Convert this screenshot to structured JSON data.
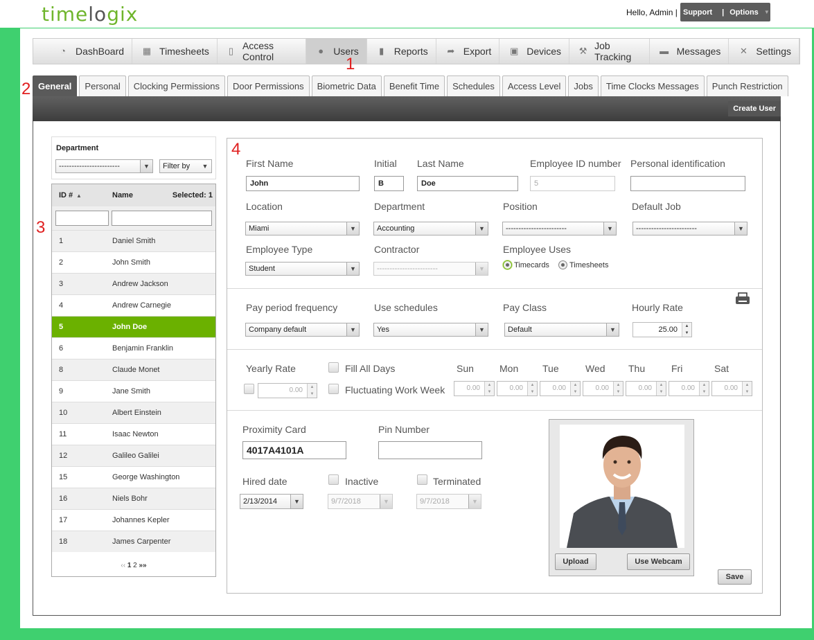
{
  "brand": {
    "logo_part1": "time",
    "logo_part2": "l",
    "logo_part3": "gix"
  },
  "topright": {
    "greeting": "Hello, Admin |",
    "support": "Support",
    "sep": "|",
    "options": "Options"
  },
  "menu": [
    {
      "label": "DashBoard",
      "icon": "dashboard-icon"
    },
    {
      "label": "Timesheets",
      "icon": "timesheets-icon"
    },
    {
      "label": "Access Control",
      "icon": "door-icon"
    },
    {
      "label": "Users",
      "icon": "user-icon"
    },
    {
      "label": "Reports",
      "icon": "bar-chart-icon"
    },
    {
      "label": "Export",
      "icon": "export-icon"
    },
    {
      "label": "Devices",
      "icon": "devices-icon"
    },
    {
      "label": "Job Tracking",
      "icon": "job-tracking-icon"
    },
    {
      "label": "Messages",
      "icon": "message-icon"
    },
    {
      "label": "Settings",
      "icon": "settings-icon"
    }
  ],
  "markers": {
    "m1": "1",
    "m2": "2",
    "m3": "3",
    "m4": "4"
  },
  "tabs": [
    "General",
    "Personal",
    "Clocking Permissions",
    "Door Permissions",
    "Biometric Data",
    "Benefit Time",
    "Schedules",
    "Access Level",
    "Jobs",
    "Time Clocks Messages",
    "Punch Restriction"
  ],
  "create_user": "Create User",
  "department_filter": {
    "label": "Department",
    "value": "------------------------",
    "filter_by": "Filter by"
  },
  "list": {
    "col_id": "ID #",
    "col_name": "Name",
    "selected": "Selected: 1",
    "rows": [
      {
        "id": "1",
        "name": "Daniel Smith"
      },
      {
        "id": "2",
        "name": "John Smith"
      },
      {
        "id": "3",
        "name": "Andrew Jackson"
      },
      {
        "id": "4",
        "name": "Andrew Carnegie"
      },
      {
        "id": "5",
        "name": "John Doe"
      },
      {
        "id": "6",
        "name": "Benjamin Franklin"
      },
      {
        "id": "8",
        "name": "Claude Monet"
      },
      {
        "id": "9",
        "name": "Jane Smith"
      },
      {
        "id": "10",
        "name": "Albert Einstein"
      },
      {
        "id": "11",
        "name": "Isaac Newton"
      },
      {
        "id": "12",
        "name": "Galileo Galilei"
      },
      {
        "id": "15",
        "name": "George Washington"
      },
      {
        "id": "16",
        "name": "Niels Bohr"
      },
      {
        "id": "17",
        "name": "Johannes Kepler"
      },
      {
        "id": "18",
        "name": "James Carpenter"
      }
    ],
    "pager": {
      "prev": "‹‹",
      "p1": "1",
      "p2": "2",
      "next": "»»"
    }
  },
  "form": {
    "first_name_label": "First Name",
    "first_name": "John",
    "initial_label": "Initial",
    "initial": "B",
    "last_name_label": "Last Name",
    "last_name": "Doe",
    "empid_label": "Employee ID number",
    "empid": "5",
    "personal_id_label": "Personal identification",
    "personal_id": "",
    "location_label": "Location",
    "location": "Miami",
    "department_label": "Department",
    "department": "Accounting",
    "position_label": "Position",
    "position": "------------------------",
    "default_job_label": "Default Job",
    "default_job": "------------------------",
    "emp_type_label": "Employee Type",
    "emp_type": "Student",
    "contractor_label": "Contractor",
    "contractor": "------------------------",
    "uses_label": "Employee Uses",
    "uses_timecards": "Timecards",
    "uses_timesheets": "Timesheets",
    "pay_period_label": "Pay period frequency",
    "pay_period": "Company default",
    "use_sched_label": "Use schedules",
    "use_sched": "Yes",
    "pay_class_label": "Pay Class",
    "pay_class": "Default",
    "hourly_label": "Hourly Rate",
    "hourly": "25.00",
    "yearly_label": "Yearly Rate",
    "yearly": "0.00",
    "fill_all_days": "Fill All Days",
    "fluctuating": "Fluctuating Work Week",
    "days": [
      "Sun",
      "Mon",
      "Tue",
      "Wed",
      "Thu",
      "Fri",
      "Sat"
    ],
    "day_value": "0.00",
    "prox_label": "Proximity Card",
    "prox": "4017A4101A",
    "pin_label": "Pin Number",
    "pin": "",
    "hired_label": "Hired date",
    "hired": "2/13/2014",
    "inactive_label": "Inactive",
    "inactive_date": "9/7/2018",
    "terminated_label": "Terminated",
    "terminated_date": "9/7/2018",
    "upload": "Upload",
    "webcam": "Use Webcam",
    "save": "Save"
  }
}
